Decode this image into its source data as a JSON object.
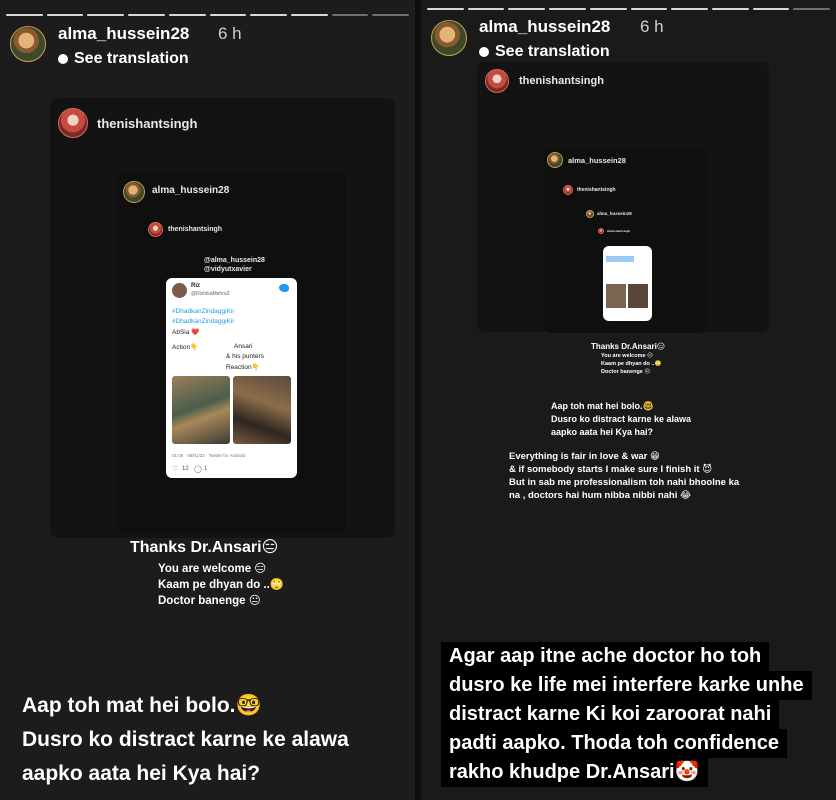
{
  "left": {
    "username": "alma_hussein28",
    "time": "6 h",
    "see_translation": "See translation",
    "repost_user": "thenishantsingh",
    "inner_user": "alma_hussein28",
    "inner_repost_user": "thenishantsingh",
    "mentions_line1": "@alma_hussein28",
    "mentions_line2": "@vidyutxavier",
    "tweet": {
      "name": "Riz",
      "handle": "@RishikaMehra3",
      "hashtag1": "#DhadkanZindaggiKii",
      "hashtag2": "#DhadkanZindaggiKii",
      "line_absia": "AbSia ❤️",
      "line_action": "Action👇",
      "line_ansari": "Ansari",
      "line_punters": "& his punters",
      "line_reaction": "Reaction👇",
      "meta": "01:05 · 06/01/22 · Twitter for Android",
      "likes": "12",
      "replies": "1"
    },
    "thanks": "Thanks Dr.Ansari😑",
    "reply1": "You are welcome 😑",
    "reply2": "Kaam pe dhyan do ..🙄",
    "reply3": "Doctor banenge 😐",
    "caption_line1": "Aap toh mat hei bolo.🤓",
    "caption_line2": "Dusro ko distract karne ke alawa",
    "caption_line3": "aapko aata hei Kya hai?"
  },
  "right": {
    "username": "alma_hussein28",
    "time": "6 h",
    "see_translation": "See translation",
    "repost_user": "thenishantsingh",
    "nested_user": "alma_hussein28",
    "nested_repost_user": "thenishantsingh",
    "deep_user": "alma_hussein28",
    "deep_repost_user": "thenishantsingh",
    "thanks": "Thanks Dr.Ansari😑",
    "reply1": "You are welcome 😑",
    "reply2": "Kaam pe dhyan do ..🙄",
    "reply3": "Doctor banenge 😐",
    "mid1": "Aap toh mat hei bolo.🤓",
    "mid2": "Dusro ko distract karne ke alawa",
    "mid3": "aapko aata hei Kya hai?",
    "para1": "Everything is fair in love & war 😁",
    "para2": "& if somebody starts I make sure I finish it 😈",
    "para3": "But in sab me professionalism toh nahi bhoolne ka",
    "para4": "na , doctors hai hum nibba nibbi nahi 😂",
    "caption_line1": "Agar aap itne ache doctor ho toh",
    "caption_line2": "dusro ke life mei interfere karke unhe",
    "caption_line3": "distract karne Ki koi zaroorat nahi",
    "caption_line4": "padti aapko. Thoda toh confidence",
    "caption_line5": "rakho khudpe Dr.Ansari🤡"
  },
  "colors": {
    "background": "#1c1c1c",
    "card": "#131313",
    "twitter_blue": "#1d9bf0",
    "caption_bg": "#000000"
  }
}
